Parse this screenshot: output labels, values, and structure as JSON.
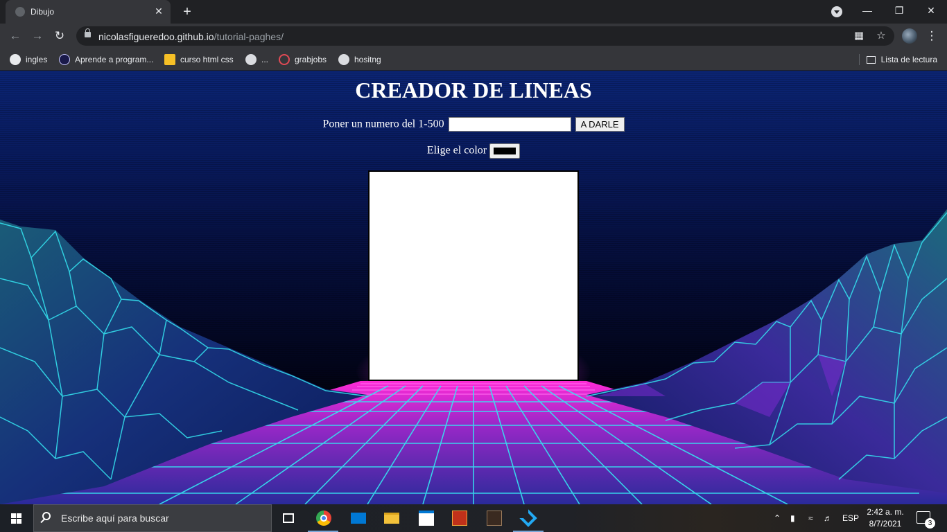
{
  "browser": {
    "tab_title": "Dibujo",
    "tab_close": "✕",
    "new_tab": "+",
    "url_host": "nicolasfigueredoo.github.io",
    "url_path": "/tutorial-paghes/",
    "bookmarks": [
      {
        "label": "ingles",
        "icon": "play-circle-icon"
      },
      {
        "label": "Aprende a program...",
        "icon": "code-logo-icon"
      },
      {
        "label": "curso html css",
        "icon": "bookmark-yellow-icon"
      },
      {
        "label": "...",
        "icon": "globe-icon"
      },
      {
        "label": "grabjobs",
        "icon": "grabjobs-logo-icon"
      },
      {
        "label": "hositng",
        "icon": "globe-icon"
      }
    ],
    "reading_list": "Lista de lectura"
  },
  "page": {
    "title": "CREADOR DE LINEAS",
    "number_label": "Poner un numero del 1-500",
    "number_value": "",
    "submit_label": "A DARLE",
    "color_label": "Elige el color",
    "color_value": "#000000"
  },
  "taskbar": {
    "search_placeholder": "Escribe aquí para buscar",
    "language": "ESP",
    "time": "2:42 a. m.",
    "date": "8/7/2021",
    "notifications": "3"
  },
  "colors": {
    "accent_magenta": "#ff2bd6",
    "grid_cyan": "#35e6f2",
    "sky_blue": "#0b2473"
  }
}
